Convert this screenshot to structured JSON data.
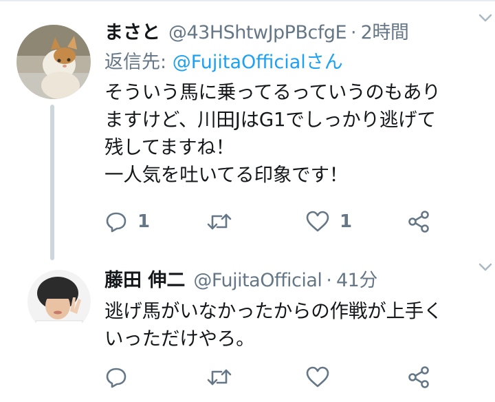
{
  "tweets": [
    {
      "author_name": "まさと",
      "handle": "@43HShtwJpPBcfgE",
      "separator": "·",
      "time": "2時間",
      "reply_prefix": "返信先: ",
      "reply_to": "@FujitaOfficialさん",
      "text": "そういう馬に乗ってるっていうのもあり\nますけど、川田JはG1でしっかり逃げて\n残してますね！\n一人気を吐いてる印象です！",
      "reply_count": "1",
      "retweet_count": "",
      "like_count": "1"
    },
    {
      "author_name": "藤田 伸二",
      "handle": "@FujitaOfficial",
      "separator": "·",
      "time": "41分",
      "text": "逃げ馬がいなかったからの作戦が上手く\nいっただけやろ。",
      "reply_count": "",
      "retweet_count": "",
      "like_count": ""
    }
  ],
  "icons": {
    "reply": "reply-icon",
    "retweet": "retweet-icon",
    "like": "heart-icon",
    "share": "share-icon",
    "menu": "chevron-down-icon"
  },
  "colors": {
    "text": "#14171a",
    "secondary": "#657786",
    "link": "#1da1f2",
    "thread_line": "#ccd6dd"
  }
}
